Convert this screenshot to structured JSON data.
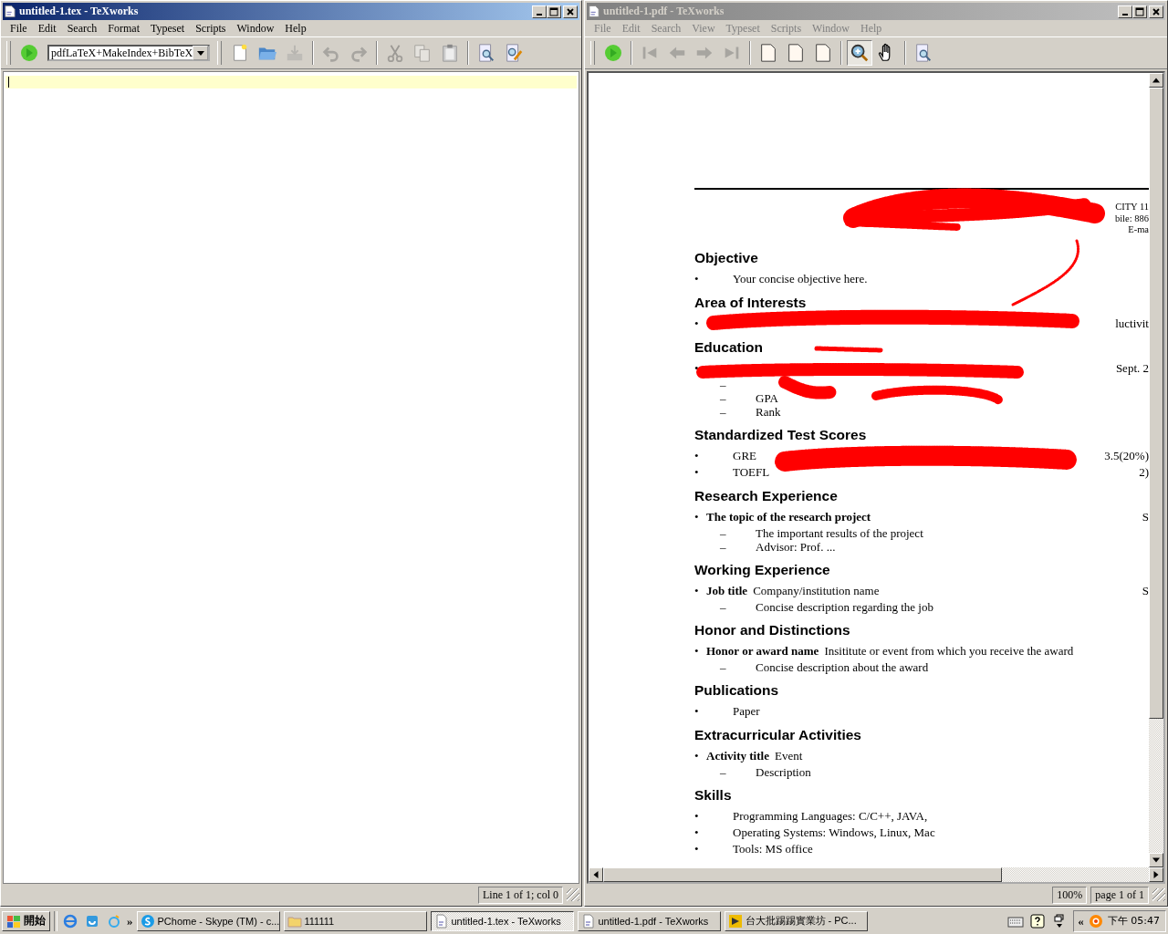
{
  "editor_window": {
    "title": "untitled-1.tex - TeXworks",
    "active": true,
    "menu": [
      "File",
      "Edit",
      "Search",
      "Format",
      "Typeset",
      "Scripts",
      "Window",
      "Help"
    ],
    "typeset_engine": "pdfLaTeX+MakeIndex+BibTeX",
    "toolbar": [
      {
        "kind": "new",
        "disabled": false
      },
      {
        "kind": "open",
        "disabled": false
      },
      {
        "kind": "save",
        "disabled": true
      },
      {
        "kind": "undo",
        "disabled": true
      },
      {
        "kind": "redo",
        "disabled": true
      },
      {
        "kind": "cut",
        "disabled": true
      },
      {
        "kind": "copy",
        "disabled": true
      },
      {
        "kind": "paste",
        "disabled": false
      },
      {
        "kind": "find",
        "disabled": false
      },
      {
        "kind": "replace",
        "disabled": false
      }
    ],
    "status": "Line 1 of 1; col 0"
  },
  "pdf_window": {
    "title": "untitled-1.pdf - TeXworks",
    "active": false,
    "menu": [
      "File",
      "Edit",
      "Search",
      "View",
      "Typeset",
      "Scripts",
      "Window",
      "Help"
    ],
    "toolbar": [
      {
        "kind": "first",
        "disabled": true,
        "selected": false
      },
      {
        "kind": "prev",
        "disabled": true,
        "selected": false
      },
      {
        "kind": "next",
        "disabled": true,
        "selected": false
      },
      {
        "kind": "last",
        "disabled": true,
        "selected": false
      },
      {
        "kind": "page",
        "disabled": false,
        "selected": false
      },
      {
        "kind": "page",
        "disabled": false,
        "selected": false
      },
      {
        "kind": "page",
        "disabled": false,
        "selected": false
      },
      {
        "kind": "zoom",
        "disabled": false,
        "selected": true
      },
      {
        "kind": "hand",
        "disabled": false,
        "selected": false
      },
      {
        "kind": "find",
        "disabled": false,
        "selected": false
      }
    ],
    "zoom": "100%",
    "page": "page 1 of 1",
    "document": {
      "contact_lines": [
        "CITY 11",
        "bile: 886",
        "E-ma"
      ],
      "sections": [
        {
          "heading": "Objective",
          "items": [
            {
              "marker": "•",
              "text": "Your concise objective here."
            }
          ]
        },
        {
          "heading": "Area of Interests",
          "items": [
            {
              "marker": "•",
              "right": "luctivit"
            }
          ]
        },
        {
          "heading": "Education",
          "items": [
            {
              "marker": "•",
              "right": "Sept. 2",
              "children": [
                {
                  "marker": "–"
                },
                {
                  "marker": "–",
                  "text": "GPA"
                },
                {
                  "marker": "–",
                  "text": "Rank"
                }
              ]
            }
          ]
        },
        {
          "heading": "Standardized Test Scores",
          "items": [
            {
              "marker": "•",
              "text": "GRE",
              "right": "3.5(20%)"
            },
            {
              "marker": "•",
              "text": "TOEFL",
              "right": "2)"
            }
          ]
        },
        {
          "heading": "Research Experience",
          "items": [
            {
              "marker": "•",
              "bold": "The topic of the research project",
              "right": "S",
              "children": [
                {
                  "marker": "–",
                  "text": "The important results of the project"
                },
                {
                  "marker": "–",
                  "text": "Advisor: Prof. ..."
                }
              ]
            }
          ]
        },
        {
          "heading": "Working Experience",
          "items": [
            {
              "marker": "•",
              "bold": "Job title",
              "text": "Company/institution name",
              "right": "S",
              "children": [
                {
                  "marker": "–",
                  "text": "Concise description regarding the job"
                }
              ]
            }
          ]
        },
        {
          "heading": "Honor and Distinctions",
          "items": [
            {
              "marker": "•",
              "bold": "Honor or award name",
              "text": "Insititute or event from which you receive the award",
              "children": [
                {
                  "marker": "–",
                  "text": "Concise description about the award"
                }
              ]
            }
          ]
        },
        {
          "heading": "Publications",
          "items": [
            {
              "marker": "•",
              "text": "Paper"
            }
          ]
        },
        {
          "heading": "Extracurricular Activities",
          "items": [
            {
              "marker": "•",
              "bold": "Activity title",
              "text": "Event",
              "children": [
                {
                  "marker": "–",
                  "text": "Description"
                }
              ]
            }
          ]
        },
        {
          "heading": "Skills",
          "items": [
            {
              "marker": "•",
              "text": "Programming Languages: C/C++, JAVA,"
            },
            {
              "marker": "•",
              "text": "Operating Systems: Windows, Linux, Mac"
            },
            {
              "marker": "•",
              "text": "Tools: MS office"
            }
          ]
        }
      ]
    }
  },
  "taskbar": {
    "start": "開始",
    "more": "»",
    "tasks": [
      {
        "label": "PChome - Skype (TM) - c...",
        "kind": "skype",
        "selected": false
      },
      {
        "label": "111111",
        "kind": "folder",
        "selected": false
      },
      {
        "label": "untitled-1.tex - TeXworks",
        "kind": "doc",
        "selected": true
      },
      {
        "label": "untitled-1.pdf - TeXworks",
        "kind": "doc",
        "selected": false
      },
      {
        "label": "台大批踢踢實業坊 - PC...",
        "kind": "terminal",
        "selected": false
      }
    ],
    "tray_collapse": "«",
    "clock": "下午 05:47"
  }
}
